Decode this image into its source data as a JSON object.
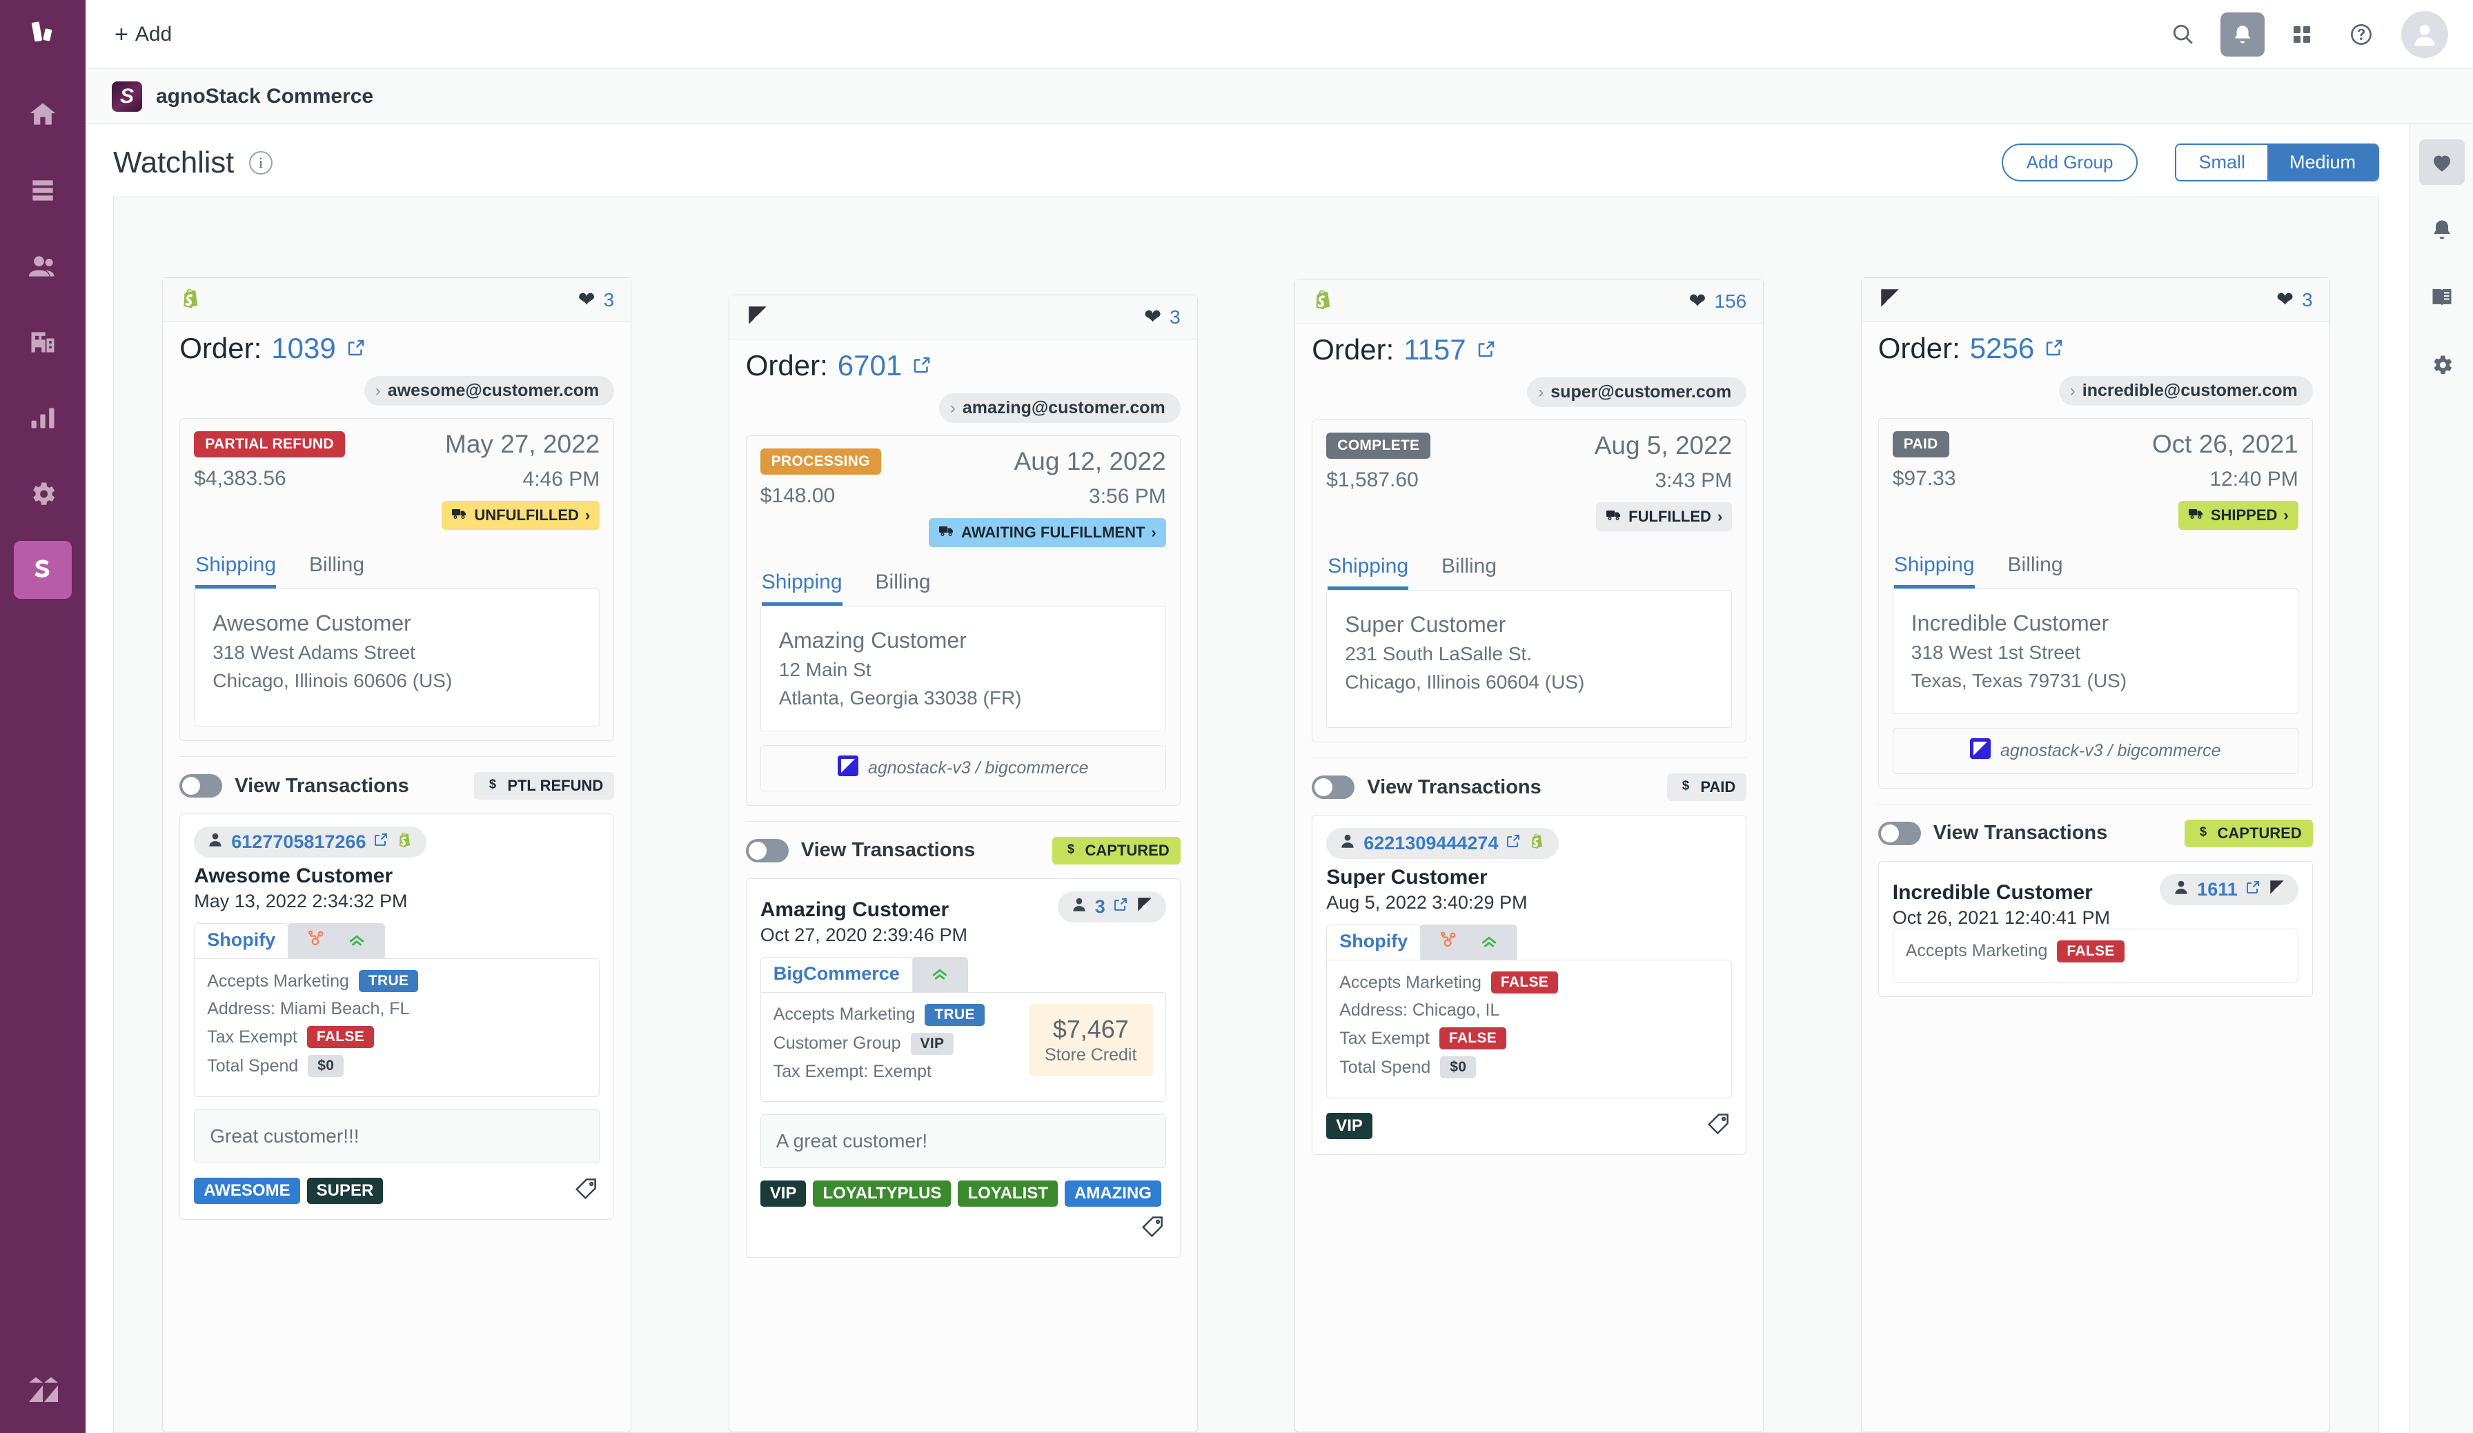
{
  "left_nav": {
    "logo": "brand-logo",
    "items": [
      {
        "icon": "home-icon",
        "name": "home"
      },
      {
        "icon": "views-icon",
        "name": "views"
      },
      {
        "icon": "customers-icon",
        "name": "customers"
      },
      {
        "icon": "organizations-icon",
        "name": "organizations"
      },
      {
        "icon": "reporting-icon",
        "name": "reporting"
      },
      {
        "icon": "admin-gear-icon",
        "name": "admin"
      },
      {
        "icon": "agnostack-icon",
        "name": "agnostack",
        "label": "S",
        "active": true
      }
    ],
    "bottom_icon": "zendesk-icon"
  },
  "topbar": {
    "add_label": "Add",
    "icons": [
      "search-icon",
      "bell-icon",
      "apps-grid-icon",
      "help-icon",
      "avatar"
    ]
  },
  "appbar": {
    "glyph": "S",
    "title": "agnoStack Commerce"
  },
  "pagehead": {
    "title": "Watchlist",
    "info_icon": "info-icon",
    "add_group_label": "Add Group",
    "size_options": [
      "Small",
      "Medium"
    ],
    "size_selected": "Medium"
  },
  "right_rail": {
    "items": [
      {
        "icon": "heart-icon",
        "name": "watchlist",
        "selected": true
      },
      {
        "icon": "bell-icon",
        "name": "notifications",
        "selected": false
      },
      {
        "icon": "book-icon",
        "name": "knowledge",
        "selected": false
      },
      {
        "icon": "gear-icon",
        "name": "settings",
        "selected": false
      }
    ]
  },
  "cards": [
    {
      "platform_icon": "shopify-icon",
      "heart_count": "3",
      "order_label": "Order:",
      "order_number": "1039",
      "email": "awesome@customer.com",
      "status": {
        "text": "PARTIAL REFUND",
        "color": "#c7373f"
      },
      "date": "May 27, 2022",
      "amount": "$4,383.56",
      "time": "4:46 PM",
      "fulfillment": {
        "text": "UNFULFILLED",
        "color": "#fcdf76"
      },
      "tabs": [
        "Shipping",
        "Billing"
      ],
      "tab_selected": "Shipping",
      "address": {
        "name": "Awesome Customer",
        "line1": "318 West Adams Street",
        "line2": "Chicago, Illinois 60606 (US)"
      },
      "source_bar": null,
      "transactions_label": "View Transactions",
      "payment": {
        "text": "PTL REFUND",
        "color": "#e9ebed"
      },
      "customer": {
        "id": "6127705817266",
        "id_position": "above",
        "id_platform_icon": "shopify-icon",
        "name": "Awesome Customer",
        "date": "May 13, 2022 2:34:32 PM",
        "source_tab": "Shopify",
        "source_extra_icons": [
          "hubspot-icon",
          "mailchimp-freddie-icon"
        ],
        "attributes": [
          {
            "label": "Accepts Marketing",
            "value": "TRUE",
            "style": "blue"
          },
          {
            "label": "Address: Miami Beach, FL",
            "value": null,
            "style": "plain"
          },
          {
            "label": "Tax Exempt",
            "value": "FALSE",
            "style": "red"
          },
          {
            "label": "Total Spend",
            "value": "$0",
            "style": "grey"
          }
        ],
        "store_credit": null,
        "note": "Great customer!!!",
        "tags": [
          {
            "text": "AWESOME",
            "color": "#2f7ed1"
          },
          {
            "text": "SUPER",
            "color": "#1b3a3a"
          }
        ]
      }
    },
    {
      "platform_icon": "bigcommerce-icon",
      "heart_count": "3",
      "order_label": "Order:",
      "order_number": "6701",
      "email": "amazing@customer.com",
      "status": {
        "text": "PROCESSING",
        "color": "#e09a3e"
      },
      "date": "Aug 12, 2022",
      "amount": "$148.00",
      "time": "3:56 PM",
      "fulfillment": {
        "text": "AWAITING FULFILLMENT",
        "color": "#8ecef5"
      },
      "tabs": [
        "Shipping",
        "Billing"
      ],
      "tab_selected": "Shipping",
      "address": {
        "name": "Amazing Customer",
        "line1": "12 Main St",
        "line2": "Atlanta, Georgia 33038 (FR)"
      },
      "source_bar": "agnostack-v3 / bigcommerce",
      "transactions_label": "View Transactions",
      "payment": {
        "text": "CAPTURED",
        "color": "#c7e05c"
      },
      "customer": {
        "id": "3",
        "id_position": "inline",
        "id_platform_icon": "bigcommerce-icon",
        "name": "Amazing Customer",
        "date": "Oct 27, 2020 2:39:46 PM",
        "source_tab": "BigCommerce",
        "source_extra_icons": [
          "mailchimp-freddie-icon"
        ],
        "attributes": [
          {
            "label": "Accepts Marketing",
            "value": "TRUE",
            "style": "blue"
          },
          {
            "label": "Customer Group",
            "value": "VIP",
            "style": "grey"
          },
          {
            "label": "Tax Exempt: Exempt",
            "value": null,
            "style": "plain"
          }
        ],
        "store_credit": {
          "amount": "$7,467",
          "label": "Store Credit"
        },
        "note": "A great customer!",
        "tags": [
          {
            "text": "VIP",
            "color": "#1b3a3a"
          },
          {
            "text": "LOYALTYPLUS",
            "color": "#3c8a2e"
          },
          {
            "text": "LOYALIST",
            "color": "#3c8a2e"
          },
          {
            "text": "AMAZING",
            "color": "#2f7ed1"
          }
        ]
      }
    },
    {
      "platform_icon": "shopify-icon",
      "heart_count": "156",
      "order_label": "Order:",
      "order_number": "1157",
      "email": "super@customer.com",
      "status": {
        "text": "COMPLETE",
        "color": "#6b737d"
      },
      "date": "Aug 5, 2022",
      "amount": "$1,587.60",
      "time": "3:43 PM",
      "fulfillment": {
        "text": "FULFILLED",
        "color": "#e9ebed"
      },
      "tabs": [
        "Shipping",
        "Billing"
      ],
      "tab_selected": "Shipping",
      "address": {
        "name": "Super Customer",
        "line1": "231 South LaSalle St.",
        "line2": "Chicago, Illinois 60604 (US)"
      },
      "source_bar": null,
      "transactions_label": "View Transactions",
      "payment": {
        "text": "PAID",
        "color": "#e9ebed"
      },
      "customer": {
        "id": "6221309444274",
        "id_position": "above",
        "id_platform_icon": "shopify-icon",
        "name": "Super Customer",
        "date": "Aug 5, 2022 3:40:29 PM",
        "source_tab": "Shopify",
        "source_extra_icons": [
          "hubspot-icon",
          "mailchimp-freddie-icon"
        ],
        "attributes": [
          {
            "label": "Accepts Marketing",
            "value": "FALSE",
            "style": "red"
          },
          {
            "label": "Address: Chicago, IL",
            "value": null,
            "style": "plain"
          },
          {
            "label": "Tax Exempt",
            "value": "FALSE",
            "style": "red"
          },
          {
            "label": "Total Spend",
            "value": "$0",
            "style": "grey"
          }
        ],
        "store_credit": null,
        "note": null,
        "tags": [
          {
            "text": "VIP",
            "color": "#1b3a3a"
          }
        ]
      }
    },
    {
      "platform_icon": "bigcommerce-icon",
      "heart_count": "3",
      "order_label": "Order:",
      "order_number": "5256",
      "email": "incredible@customer.com",
      "status": {
        "text": "PAID",
        "color": "#6b737d"
      },
      "date": "Oct 26, 2021",
      "amount": "$97.33",
      "time": "12:40 PM",
      "fulfillment": {
        "text": "SHIPPED",
        "color": "#c7e05c"
      },
      "tabs": [
        "Shipping",
        "Billing"
      ],
      "tab_selected": "Shipping",
      "address": {
        "name": "Incredible Customer",
        "line1": "318 West 1st Street",
        "line2": "Texas, Texas 79731 (US)"
      },
      "source_bar": "agnostack-v3 / bigcommerce",
      "transactions_label": "View Transactions",
      "payment": {
        "text": "CAPTURED",
        "color": "#c7e05c"
      },
      "customer": {
        "id": "1611",
        "id_position": "inline",
        "id_platform_icon": "bigcommerce-icon",
        "name": "Incredible Customer",
        "date": "Oct 26, 2021 12:40:41 PM",
        "source_tab": null,
        "source_extra_icons": [],
        "attributes": [
          {
            "label": "Accepts Marketing",
            "value": "FALSE",
            "style": "red"
          }
        ],
        "store_credit": null,
        "note": null,
        "tags": []
      }
    }
  ]
}
